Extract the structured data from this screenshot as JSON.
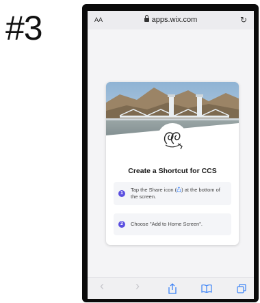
{
  "step_label": "#3",
  "browser": {
    "text_size_label": "AA",
    "url": "apps.wix.com",
    "reload_glyph": "↻"
  },
  "card": {
    "title": "Create a Shortcut for CCS",
    "steps": [
      {
        "number": "1",
        "text_before": "Tap the Share icon (",
        "text_after": ") at the bottom of the screen."
      },
      {
        "number": "2",
        "text": "Choose \"Add to Home Screen\"."
      }
    ]
  },
  "toolbar": {
    "back_glyph": "‹",
    "forward_glyph": "›"
  },
  "colors": {
    "accent": "#5b4fe0",
    "ios_blue": "#3b82f6"
  }
}
